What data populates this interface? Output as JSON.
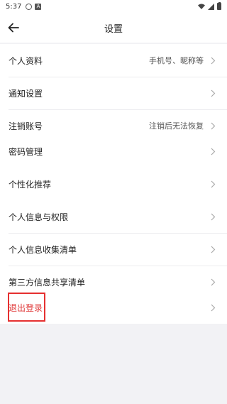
{
  "status_bar": {
    "time": "5:37",
    "notification_icons": [
      "settings-icon",
      "a-icon"
    ],
    "right_icons": [
      "wifi-icon",
      "signal-icon",
      "battery-icon"
    ]
  },
  "nav": {
    "title": "设置",
    "back_icon": "arrow-left-icon"
  },
  "groups": [
    {
      "rows": [
        {
          "label": "个人资料",
          "value": "手机号、昵称等"
        },
        {
          "label": "通知设置",
          "value": ""
        },
        {
          "label": "注销账号",
          "value": "注销后无法恢复"
        }
      ]
    },
    {
      "rows": [
        {
          "label": "密码管理",
          "value": ""
        }
      ]
    },
    {
      "rows": [
        {
          "label": "个性化推荐",
          "value": ""
        }
      ]
    },
    {
      "rows": [
        {
          "label": "个人信息与权限",
          "value": ""
        },
        {
          "label": "个人信息收集清单",
          "value": ""
        },
        {
          "label": "第三方信息共享清单",
          "value": ""
        }
      ]
    },
    {
      "rows": [
        {
          "label": "退出登录",
          "value": ""
        }
      ]
    }
  ],
  "colors": {
    "logout_text": "#e03a3a",
    "highlight_border": "#e53030",
    "background": "#f2f2f5"
  }
}
